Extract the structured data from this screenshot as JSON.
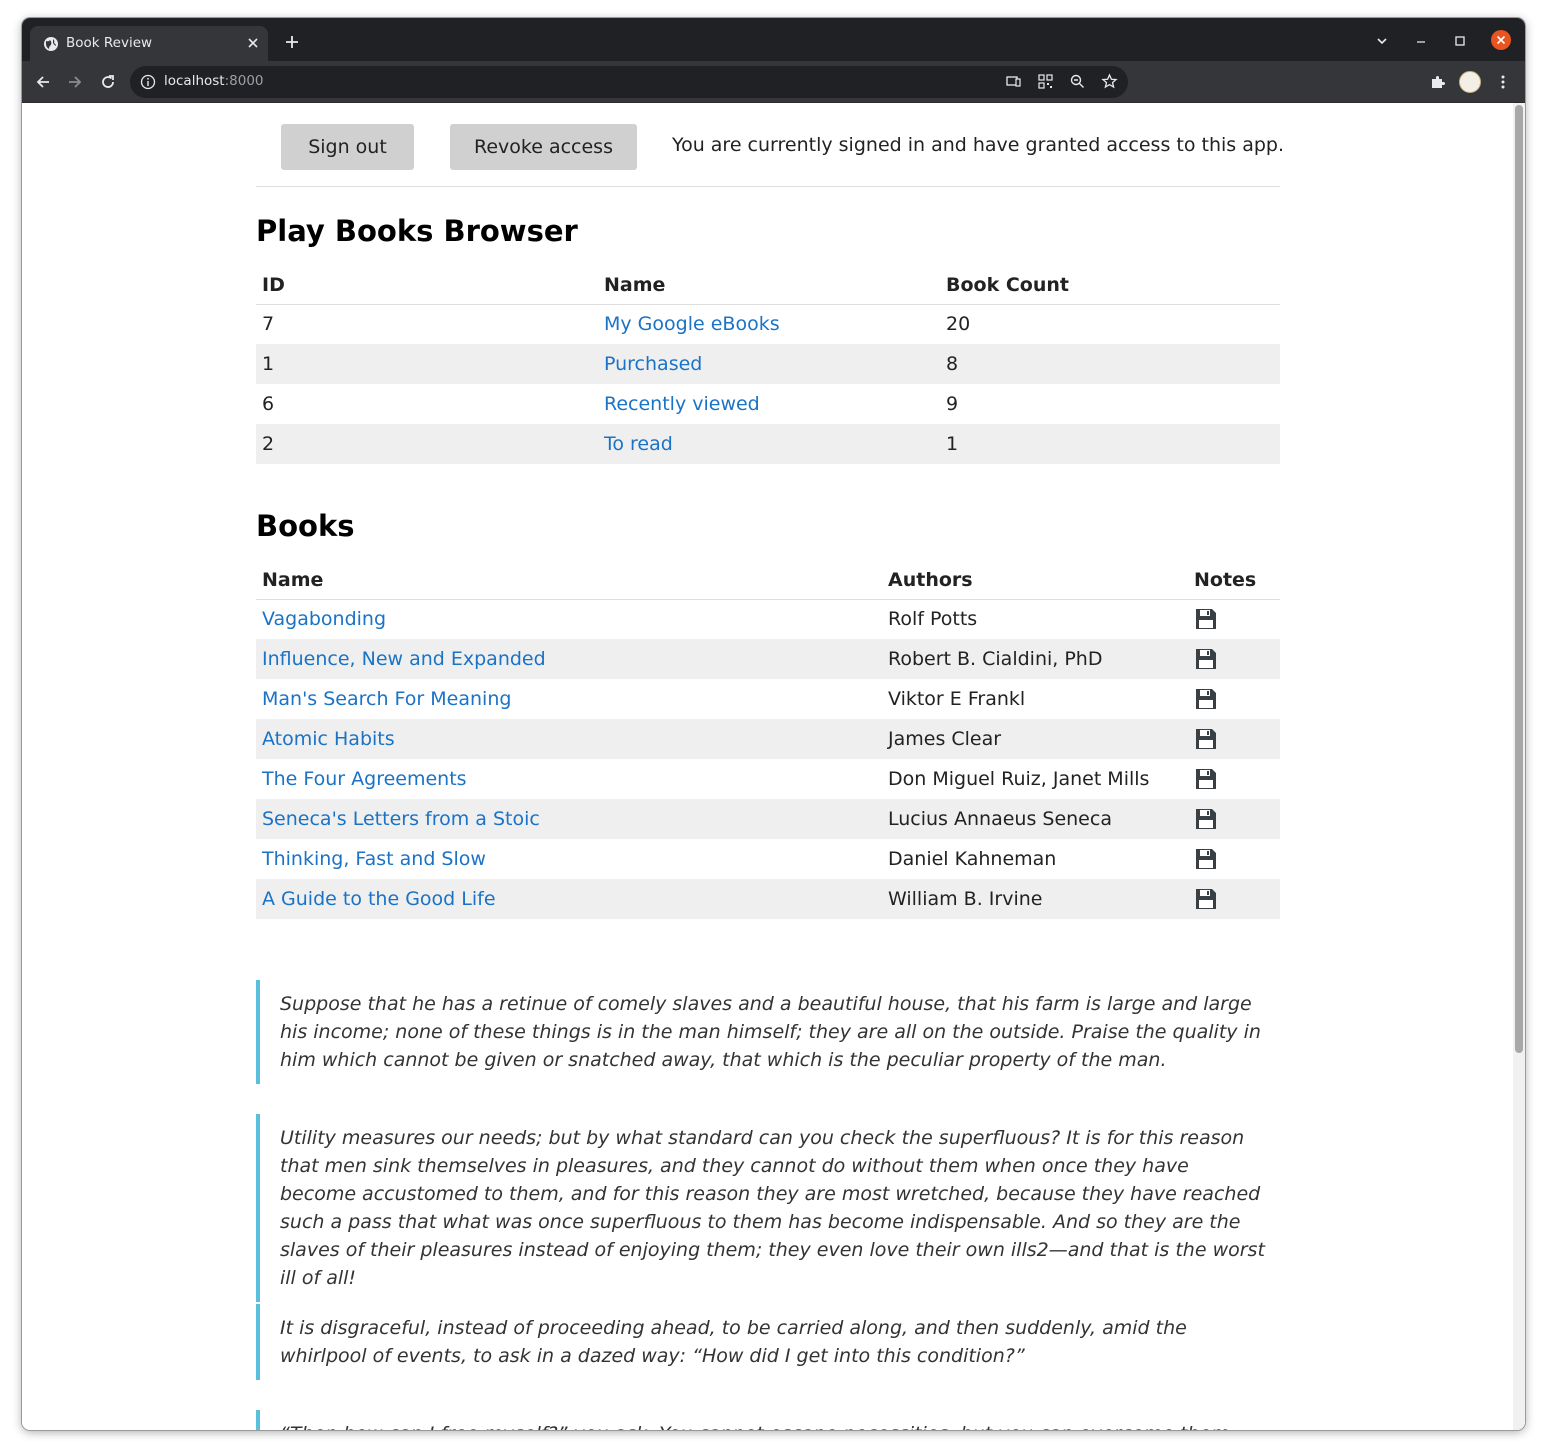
{
  "browser": {
    "tab_title": "Book Review",
    "url_host": "localhost",
    "url_port": ":8000"
  },
  "auth": {
    "sign_out_label": "Sign out",
    "revoke_label": "Revoke access",
    "status_text": "You are currently signed in and have granted access to this app."
  },
  "shelves": {
    "title": "Play Books Browser",
    "headers": [
      "ID",
      "Name",
      "Book Count"
    ],
    "rows": [
      {
        "id": "7",
        "name": "My Google eBooks",
        "count": "20"
      },
      {
        "id": "1",
        "name": "Purchased",
        "count": "8"
      },
      {
        "id": "6",
        "name": "Recently viewed",
        "count": "9"
      },
      {
        "id": "2",
        "name": "To read",
        "count": "1"
      }
    ]
  },
  "books": {
    "title": "Books",
    "headers": [
      "Name",
      "Authors",
      "Notes"
    ],
    "rows": [
      {
        "name": "Vagabonding",
        "authors": "Rolf Potts"
      },
      {
        "name": "Influence, New and Expanded",
        "authors": "Robert B. Cialdini, PhD"
      },
      {
        "name": "Man's Search For Meaning",
        "authors": "Viktor E Frankl"
      },
      {
        "name": "Atomic Habits",
        "authors": "James Clear"
      },
      {
        "name": "The Four Agreements",
        "authors": "Don Miguel Ruiz, Janet Mills"
      },
      {
        "name": "Seneca's Letters from a Stoic",
        "authors": "Lucius Annaeus Seneca"
      },
      {
        "name": "Thinking, Fast and Slow",
        "authors": "Daniel Kahneman"
      },
      {
        "name": "A Guide to the Good Life",
        "authors": "William B. Irvine"
      }
    ],
    "notes_icon": "floppy-disk-icon"
  },
  "quotes": [
    "Suppose that he has a retinue of comely slaves and a beautiful house, that his farm is large and large his income; none of these things is in the man himself; they are all on the outside. Praise the quality in him which cannot be given or snatched away, that which is the peculiar property of the man.",
    "Utility measures our needs; but by what standard can you check the superfluous? It is for this reason that men sink themselves in pleasures, and they cannot do without them when once they have become accustomed to them, and for this reason they are most wretched, because they have reached such a pass that what was once superfluous to them has become indispensable. And so they are the slaves of their pleasures instead of enjoying them; they even love their own ills2—and that is the worst ill of all!",
    "It is disgraceful, instead of proceeding ahead, to be carried along, and then suddenly, amid the whirlpool of events, to ask in a dazed way: “How did I get into this condition?”",
    "“Then how can I free myself?” you ask. You cannot escape necessities, but you can overcome them:"
  ],
  "colors": {
    "link": "#1a73c6",
    "quote_border": "#5bc0de",
    "button_bg": "#d0d0d0",
    "row_alt": "#efefef"
  }
}
